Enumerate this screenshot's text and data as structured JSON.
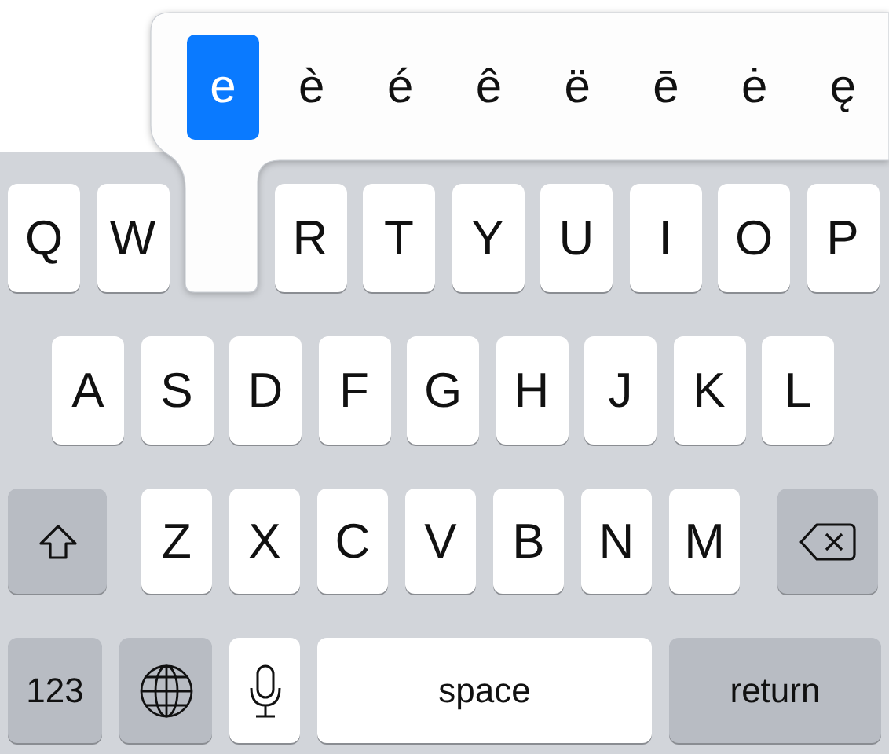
{
  "accent_popup": {
    "options": [
      {
        "label": "e",
        "selected": true
      },
      {
        "label": "è",
        "selected": false
      },
      {
        "label": "é",
        "selected": false
      },
      {
        "label": "ê",
        "selected": false
      },
      {
        "label": "ë",
        "selected": false
      },
      {
        "label": "ē",
        "selected": false
      },
      {
        "label": "ė",
        "selected": false
      },
      {
        "label": "ę",
        "selected": false
      }
    ]
  },
  "keyboard": {
    "rows": [
      {
        "keys": [
          {
            "kind": "letter",
            "label": "Q"
          },
          {
            "kind": "letter",
            "label": "W"
          },
          {
            "kind": "held"
          },
          {
            "kind": "letter",
            "label": "R"
          },
          {
            "kind": "letter",
            "label": "T"
          },
          {
            "kind": "letter",
            "label": "Y"
          },
          {
            "kind": "letter",
            "label": "U"
          },
          {
            "kind": "letter",
            "label": "I"
          },
          {
            "kind": "letter",
            "label": "O"
          },
          {
            "kind": "letter",
            "label": "P"
          }
        ]
      },
      {
        "keys": [
          {
            "kind": "letter",
            "label": "A"
          },
          {
            "kind": "letter",
            "label": "S"
          },
          {
            "kind": "letter",
            "label": "D"
          },
          {
            "kind": "letter",
            "label": "F"
          },
          {
            "kind": "letter",
            "label": "G"
          },
          {
            "kind": "letter",
            "label": "H"
          },
          {
            "kind": "letter",
            "label": "J"
          },
          {
            "kind": "letter",
            "label": "K"
          },
          {
            "kind": "letter",
            "label": "L"
          }
        ]
      },
      {
        "keys": [
          {
            "kind": "shift"
          },
          {
            "kind": "letter",
            "label": "Z"
          },
          {
            "kind": "letter",
            "label": "X"
          },
          {
            "kind": "letter",
            "label": "C"
          },
          {
            "kind": "letter",
            "label": "V"
          },
          {
            "kind": "letter",
            "label": "B"
          },
          {
            "kind": "letter",
            "label": "N"
          },
          {
            "kind": "letter",
            "label": "M"
          },
          {
            "kind": "delete"
          }
        ]
      },
      {
        "keys": [
          {
            "kind": "mode",
            "label": "123"
          },
          {
            "kind": "globe"
          },
          {
            "kind": "mic"
          },
          {
            "kind": "space",
            "label": "space"
          },
          {
            "kind": "return",
            "label": "return"
          }
        ]
      }
    ]
  }
}
